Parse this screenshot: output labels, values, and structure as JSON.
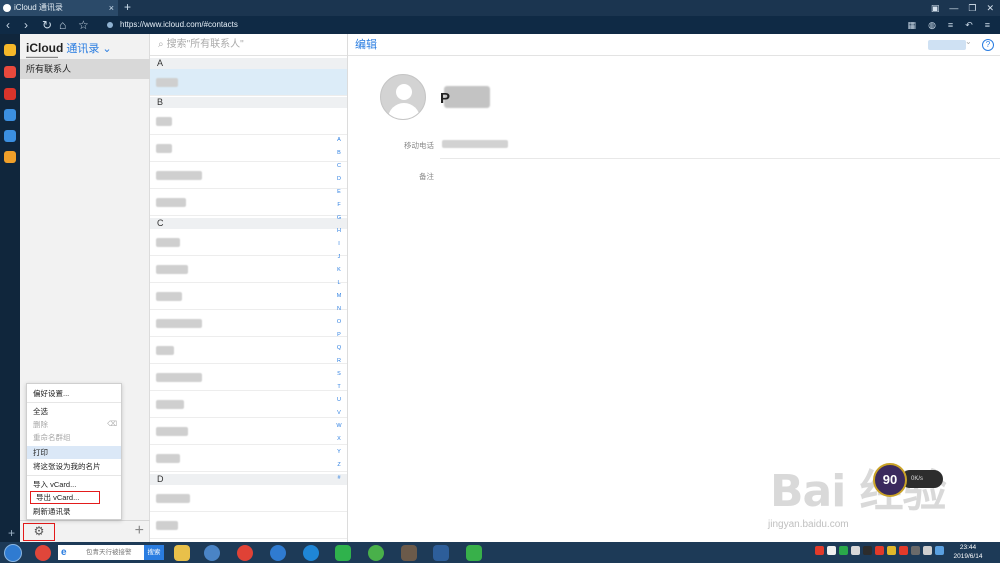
{
  "browser": {
    "tab_title": "iCloud 通讯录",
    "tab_close": "×",
    "new_tab": "+",
    "url": "https://www.icloud.com/#contacts"
  },
  "app": {
    "brand": "iCloud",
    "section": "通讯录",
    "group_all": "所有联系人",
    "search_placeholder": "搜索\"所有联系人\"",
    "edit": "编辑",
    "help": "?",
    "contact_initial": "P"
  },
  "sections": [
    "A",
    "B",
    "C",
    "D"
  ],
  "alphabet": [
    "A",
    "B",
    "C",
    "D",
    "E",
    "F",
    "G",
    "H",
    "I",
    "J",
    "K",
    "L",
    "M",
    "N",
    "O",
    "P",
    "Q",
    "R",
    "S",
    "T",
    "U",
    "V",
    "W",
    "X",
    "Y",
    "Z",
    "#"
  ],
  "fields": {
    "mobile_label": "移动电话",
    "notes_label": "备注"
  },
  "menu": {
    "items": [
      {
        "label": "偏好设置...",
        "state": "normal"
      },
      {
        "label": "全选",
        "state": "normal"
      },
      {
        "label": "删除",
        "state": "disabled"
      },
      {
        "label": "重命名群组",
        "state": "disabled"
      },
      {
        "label": "打印",
        "state": "highlight"
      },
      {
        "label": "将这张设为我的名片",
        "state": "normal"
      },
      {
        "label": "导入 vCard...",
        "state": "normal"
      },
      {
        "label": "导出 vCard...",
        "state": "boxed"
      },
      {
        "label": "刷新通讯录",
        "state": "normal"
      }
    ]
  },
  "watermark": {
    "text": "Bai 经验",
    "url": "jingyan.baidu.com",
    "badge_value": "90",
    "badge_speed": "0K/s"
  },
  "taskbar": {
    "search_placeholder": "包青天行被接警",
    "search_button": "搜索",
    "time": "23:44",
    "date": "2019/6/14"
  }
}
